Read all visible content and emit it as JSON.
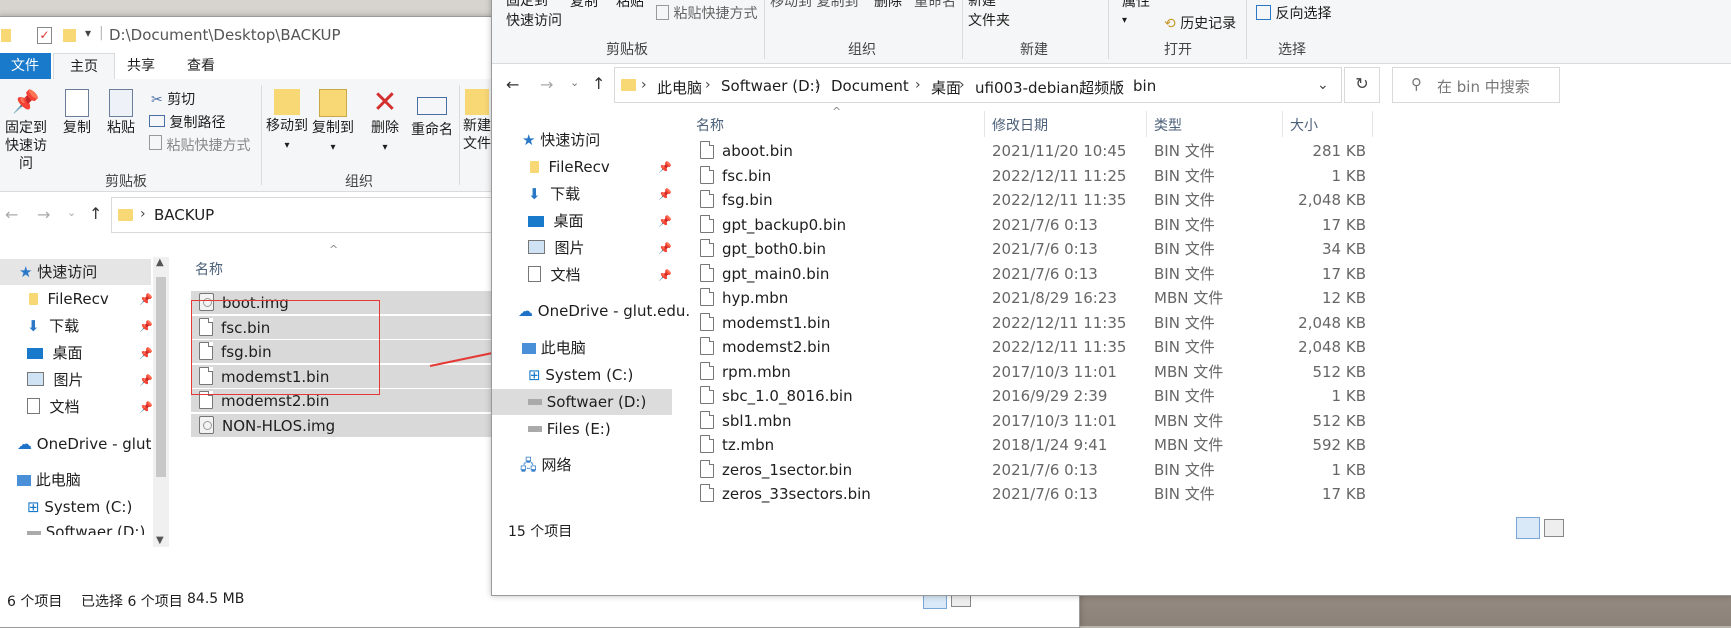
{
  "colors": {
    "accent": "#0078d7",
    "selected_row": "#cce8ff",
    "red_annotation": "#e53935",
    "folder": "#f8d775"
  },
  "left": {
    "title_path": "D:\\Document\\Desktop\\BACKUP",
    "tabs": {
      "file": "文件",
      "home": "主页",
      "share": "共享",
      "view": "查看"
    },
    "ribbon": {
      "pin": "固定到\n快速访问",
      "pin_l1": "固定到",
      "pin_l2": "快速访问",
      "copy": "复制",
      "paste": "粘贴",
      "cut": "剪切",
      "copy_path": "复制路径",
      "paste_shortcut": "粘贴快捷方式",
      "move_to": "移动到",
      "copy_to": "复制到",
      "delete": "删除",
      "rename": "重命名",
      "new_l1": "新建",
      "new_l2": "文件",
      "group_clipboard": "剪贴板",
      "group_organize": "组织"
    },
    "address": {
      "folder": "BACKUP"
    },
    "col_name": "名称",
    "nav": {
      "quick_access": "快速访问",
      "filerecv": "FileRecv",
      "downloads": "下载",
      "desktop": "桌面",
      "pictures": "图片",
      "documents": "文档",
      "onedrive": "OneDrive - glut.e",
      "this_pc": "此电脑",
      "system": "System (C:)",
      "softwaer": "Softwaer (D:)"
    },
    "files": [
      {
        "name": "boot.img"
      },
      {
        "name": "fsc.bin"
      },
      {
        "name": "fsg.bin"
      },
      {
        "name": "modemst1.bin"
      },
      {
        "name": "modemst2.bin"
      },
      {
        "name": "NON-HLOS.img"
      }
    ],
    "status": {
      "count": "6 个项目",
      "selected": "已选择 6 个项目",
      "size": "84.5 MB"
    }
  },
  "right": {
    "ribbon": {
      "pin_l1": "固定到",
      "pin_l2": "快速访问",
      "copy": "复制",
      "paste": "粘贴",
      "paste_shortcut": "粘贴快捷方式",
      "move_copy": "移动到 复制到",
      "delete": "删除",
      "rename": "重命名",
      "new_l1": "新建",
      "new_l2": "文件夹",
      "properties": "属性",
      "history": "历史记录",
      "invert": "反向选择",
      "group_clipboard": "剪贴板",
      "group_organize": "组织",
      "group_new": "新建",
      "group_open": "打开",
      "group_select": "选择"
    },
    "breadcrumb": [
      "此电脑",
      "Softwaer (D:)",
      "Document",
      "桌面",
      "ufi003-debian超频版",
      "bin"
    ],
    "search_placeholder": "在 bin 中搜索",
    "cols": {
      "name": "名称",
      "date": "修改日期",
      "type": "类型",
      "size": "大小"
    },
    "nav": {
      "quick_access": "快速访问",
      "filerecv": "FileRecv",
      "downloads": "下载",
      "desktop": "桌面",
      "pictures": "图片",
      "documents": "文档",
      "onedrive": "OneDrive - glut.edu.",
      "this_pc": "此电脑",
      "system": "System (C:)",
      "softwaer": "Softwaer (D:)",
      "files": "Files (E:)",
      "network": "网络"
    },
    "files": [
      {
        "name": "aboot.bin",
        "date": "2021/11/20 10:45",
        "type": "BIN 文件",
        "size": "281 KB"
      },
      {
        "name": "fsc.bin",
        "date": "2022/12/11 11:25",
        "type": "BIN 文件",
        "size": "1 KB"
      },
      {
        "name": "fsg.bin",
        "date": "2022/12/11 11:35",
        "type": "BIN 文件",
        "size": "2,048 KB"
      },
      {
        "name": "gpt_backup0.bin",
        "date": "2021/7/6 0:13",
        "type": "BIN 文件",
        "size": "17 KB"
      },
      {
        "name": "gpt_both0.bin",
        "date": "2021/7/6 0:13",
        "type": "BIN 文件",
        "size": "34 KB"
      },
      {
        "name": "gpt_main0.bin",
        "date": "2021/7/6 0:13",
        "type": "BIN 文件",
        "size": "17 KB"
      },
      {
        "name": "hyp.mbn",
        "date": "2021/8/29 16:23",
        "type": "MBN 文件",
        "size": "12 KB"
      },
      {
        "name": "modemst1.bin",
        "date": "2022/12/11 11:35",
        "type": "BIN 文件",
        "size": "2,048 KB"
      },
      {
        "name": "modemst2.bin",
        "date": "2022/12/11 11:35",
        "type": "BIN 文件",
        "size": "2,048 KB"
      },
      {
        "name": "rpm.mbn",
        "date": "2017/10/3 11:01",
        "type": "MBN 文件",
        "size": "512 KB"
      },
      {
        "name": "sbc_1.0_8016.bin",
        "date": "2016/9/29 2:39",
        "type": "BIN 文件",
        "size": "1 KB"
      },
      {
        "name": "sbl1.mbn",
        "date": "2017/10/3 11:01",
        "type": "MBN 文件",
        "size": "512 KB"
      },
      {
        "name": "tz.mbn",
        "date": "2018/1/24 9:41",
        "type": "MBN 文件",
        "size": "592 KB"
      },
      {
        "name": "zeros_1sector.bin",
        "date": "2021/7/6 0:13",
        "type": "BIN 文件",
        "size": "1 KB"
      },
      {
        "name": "zeros_33sectors.bin",
        "date": "2021/7/6 0:13",
        "type": "BIN 文件",
        "size": "17 KB"
      }
    ],
    "status": {
      "count": "15 个项目"
    }
  }
}
